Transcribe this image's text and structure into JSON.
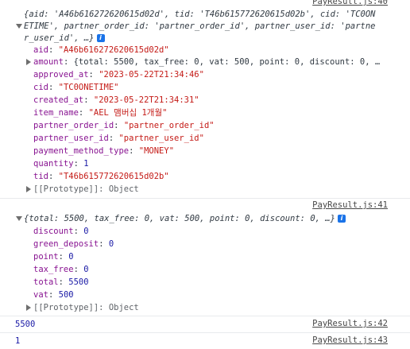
{
  "entries": [
    {
      "source": "PayResult.js:40",
      "summary_line1": "{aid: 'A46b616272620615d02d', tid: 'T46b615772620615d02b', cid: 'TC0ON",
      "summary_line2": "ETIME', partner_order_id: 'partner_order_id', partner_user_id: 'partne",
      "summary_line3": "r_user_id', …}",
      "info": "i",
      "props": [
        {
          "key": "aid",
          "value": "\"A46b616272620615d02d\"",
          "type": "str"
        },
        {
          "key": "amount",
          "value": "{total: 5500, tax_free: 0, vat: 500, point: 0, discount: 0, …",
          "type": "obj"
        },
        {
          "key": "approved_at",
          "value": "\"2023-05-22T21:34:46\"",
          "type": "str"
        },
        {
          "key": "cid",
          "value": "\"TC0ONETIME\"",
          "type": "str"
        },
        {
          "key": "created_at",
          "value": "\"2023-05-22T21:34:31\"",
          "type": "str"
        },
        {
          "key": "item_name",
          "value": "\"AEL 맴버십 1개월\"",
          "type": "str"
        },
        {
          "key": "partner_order_id",
          "value": "\"partner_order_id\"",
          "type": "str"
        },
        {
          "key": "partner_user_id",
          "value": "\"partner_user_id\"",
          "type": "str"
        },
        {
          "key": "payment_method_type",
          "value": "\"MONEY\"",
          "type": "str"
        },
        {
          "key": "quantity",
          "value": "1",
          "type": "num"
        },
        {
          "key": "tid",
          "value": "\"T46b615772620615d02b\"",
          "type": "str"
        }
      ],
      "prototype": "[[Prototype]]: Object"
    },
    {
      "source": "PayResult.js:41",
      "summary": "{total: 5500, tax_free: 0, vat: 500, point: 0, discount: 0, …}",
      "info": "i",
      "props": [
        {
          "key": "discount",
          "value": "0"
        },
        {
          "key": "green_deposit",
          "value": "0"
        },
        {
          "key": "point",
          "value": "0"
        },
        {
          "key": "tax_free",
          "value": "0"
        },
        {
          "key": "total",
          "value": "5500"
        },
        {
          "key": "vat",
          "value": "500"
        }
      ],
      "prototype": "[[Prototype]]: Object"
    },
    {
      "source": "PayResult.js:42",
      "value": "5500"
    },
    {
      "source": "PayResult.js:43",
      "value": "1"
    }
  ]
}
